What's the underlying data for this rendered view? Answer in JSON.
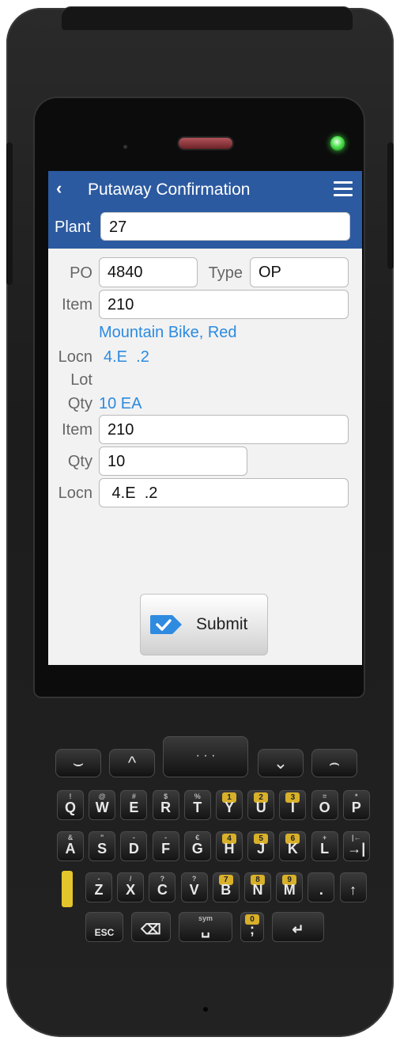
{
  "header": {
    "title": "Putaway Confirmation",
    "back_glyph": "‹"
  },
  "plant": {
    "label": "Plant",
    "value": "27"
  },
  "form": {
    "po_label": "PO",
    "po_value": "4840",
    "type_label": "Type",
    "type_value": "OP",
    "item_label": "Item",
    "item_value": "210",
    "description": "Mountain Bike, Red",
    "locn_label": "Locn",
    "locn_value": "4.E  .2",
    "lot_label": "Lot",
    "qty_label": "Qty",
    "qty_value": "10 EA",
    "item2_label": "Item",
    "item2_value": "210",
    "qty2_label": "Qty",
    "qty2_value": "10",
    "locn2_label": "Locn",
    "locn2_value": " 4.E  .2"
  },
  "submit": {
    "label": "Submit",
    "icon": "check-tag-icon"
  },
  "keypad": {
    "nav": [
      "call-icon",
      "up-icon",
      "scan-icon",
      "down-icon",
      "end-call-icon"
    ],
    "row1": [
      {
        "sym": "!",
        "num": "",
        "ch": "Q"
      },
      {
        "sym": "@",
        "num": "",
        "ch": "W"
      },
      {
        "sym": "#",
        "num": "",
        "ch": "E"
      },
      {
        "sym": "$",
        "num": "",
        "ch": "R"
      },
      {
        "sym": "%",
        "num": "",
        "ch": "T"
      },
      {
        "sym": "",
        "num": "1",
        "ch": "Y"
      },
      {
        "sym": "",
        "num": "2",
        "ch": "U"
      },
      {
        "sym": "",
        "num": "3",
        "ch": "I"
      },
      {
        "sym": "=",
        "num": "",
        "ch": "O"
      },
      {
        "sym": "*",
        "num": "",
        "ch": "P"
      }
    ],
    "row2": [
      {
        "sym": "&",
        "num": "",
        "ch": "A"
      },
      {
        "sym": "\"",
        "num": "",
        "ch": "S"
      },
      {
        "sym": "-",
        "num": "",
        "ch": "D"
      },
      {
        "sym": "-",
        "num": "",
        "ch": "F"
      },
      {
        "sym": "€",
        "num": "",
        "ch": "G"
      },
      {
        "sym": "",
        "num": "4",
        "ch": "H"
      },
      {
        "sym": "",
        "num": "5",
        "ch": "J"
      },
      {
        "sym": "",
        "num": "6",
        "ch": "K"
      },
      {
        "sym": "+",
        "num": "",
        "ch": "L"
      },
      {
        "sym": "|←",
        "num": "",
        "ch": "→|"
      }
    ],
    "row3": [
      {
        "sym": "-",
        "num": "",
        "ch": "Z"
      },
      {
        "sym": "/",
        "num": "",
        "ch": "X"
      },
      {
        "sym": "?",
        "num": "",
        "ch": "C"
      },
      {
        "sym": "?",
        "num": "",
        "ch": "V"
      },
      {
        "sym": "",
        "num": "7",
        "ch": "B"
      },
      {
        "sym": "",
        "num": "8",
        "ch": "N"
      },
      {
        "sym": "",
        "num": "9",
        "ch": "M"
      },
      {
        "sym": "",
        "num": "",
        "ch": "."
      },
      {
        "sym": "",
        "num": "",
        "ch": "↑"
      }
    ],
    "row4": [
      {
        "sym": "",
        "num": "",
        "ch": "ESC"
      },
      {
        "sym": "",
        "num": "",
        "ch": "⌫"
      },
      {
        "sym": "sym",
        "num": "",
        "ch": "␣"
      },
      {
        "sym": "",
        "num": "0",
        "ch": ";"
      },
      {
        "sym": "",
        "num": "",
        "ch": "↵"
      }
    ]
  },
  "colors": {
    "brand": "#2c5aa0",
    "link": "#2c8ae0",
    "led": "#4ee24e"
  }
}
